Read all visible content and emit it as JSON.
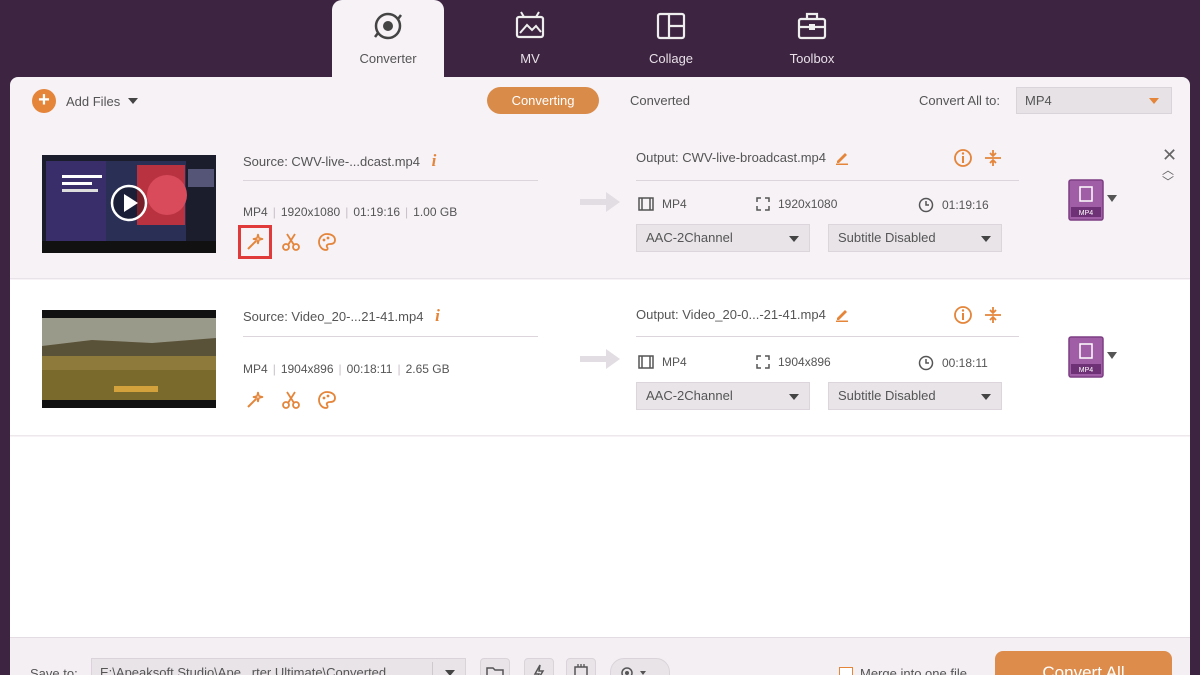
{
  "nav": {
    "tabs": [
      {
        "label": "Converter",
        "icon": "converter-icon"
      },
      {
        "label": "MV",
        "icon": "mv-icon"
      },
      {
        "label": "Collage",
        "icon": "collage-icon"
      },
      {
        "label": "Toolbox",
        "icon": "toolbox-icon"
      }
    ]
  },
  "toolbar": {
    "add_files": "Add Files",
    "converting": "Converting",
    "converted": "Converted",
    "convert_all_to": "Convert All to:",
    "convert_all_format": "MP4"
  },
  "files": [
    {
      "source": "Source: CWV-live-...dcast.mp4",
      "format": "MP4",
      "resolution": "1920x1080",
      "duration": "01:19:16",
      "size": "1.00 GB",
      "output": "Output: CWV-live-broadcast.mp4",
      "out_format": "MP4",
      "out_resolution": "1920x1080",
      "out_duration": "01:19:16",
      "audio": "AAC-2Channel",
      "subtitle": "Subtitle Disabled",
      "badge": "MP4"
    },
    {
      "source": "Source: Video_20-...21-41.mp4",
      "format": "MP4",
      "resolution": "1904x896",
      "duration": "00:18:11",
      "size": "2.65 GB",
      "output": "Output: Video_20-0...-21-41.mp4",
      "out_format": "MP4",
      "out_resolution": "1904x896",
      "out_duration": "00:18:11",
      "audio": "AAC-2Channel",
      "subtitle": "Subtitle Disabled",
      "badge": "MP4"
    }
  ],
  "bottom": {
    "save_to": "Save to:",
    "path": "E:\\Apeaksoft Studio\\Ape...rter Ultimate\\Converted",
    "merge": "Merge into one file",
    "convert_all": "Convert All"
  },
  "colors": {
    "accent": "#e4853a",
    "background": "#3d2541",
    "panel": "#f6f2f6",
    "highlight": "#e03a3a"
  }
}
